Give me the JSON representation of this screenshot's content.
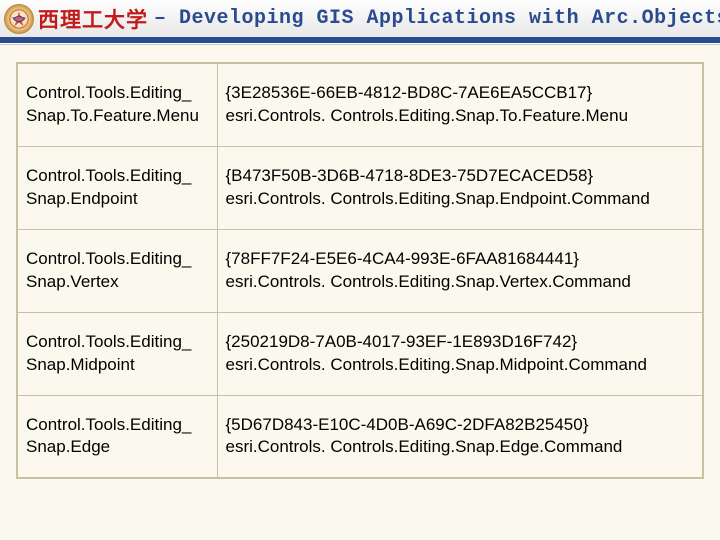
{
  "header": {
    "cn_text": "西理工大学",
    "en_text": "– Developing GIS Applications with Arc.Objects using C#. NE",
    "logo_name": "university-emblem"
  },
  "table": {
    "rows": [
      {
        "name_line1": "Control.Tools.Editing_",
        "name_line2": "Snap.To.Feature.Menu",
        "guid": "{3E28536E-66EB-4812-BD8C-7AE6EA5CCB17}",
        "path": "esri.Controls. Controls.Editing.Snap.To.Feature.Menu"
      },
      {
        "name_line1": "Control.Tools.Editing_",
        "name_line2": "Snap.Endpoint",
        "guid": "{B473F50B-3D6B-4718-8DE3-75D7ECACED58}",
        "path": "esri.Controls. Controls.Editing.Snap.Endpoint.Command"
      },
      {
        "name_line1": "Control.Tools.Editing_",
        "name_line2": "Snap.Vertex",
        "guid": "{78FF7F24-E5E6-4CA4-993E-6FAA81684441}",
        "path": "esri.Controls. Controls.Editing.Snap.Vertex.Command"
      },
      {
        "name_line1": "Control.Tools.Editing_",
        "name_line2": "Snap.Midpoint",
        "guid": "{250219D8-7A0B-4017-93EF-1E893D16F742}",
        "path": "esri.Controls. Controls.Editing.Snap.Midpoint.Command"
      },
      {
        "name_line1": "Control.Tools.Editing_",
        "name_line2": "Snap.Edge",
        "guid": "{5D67D843-E10C-4D0B-A69C-2DFA82B25450}",
        "path": "esri.Controls. Controls.Editing.Snap.Edge.Command"
      }
    ]
  }
}
